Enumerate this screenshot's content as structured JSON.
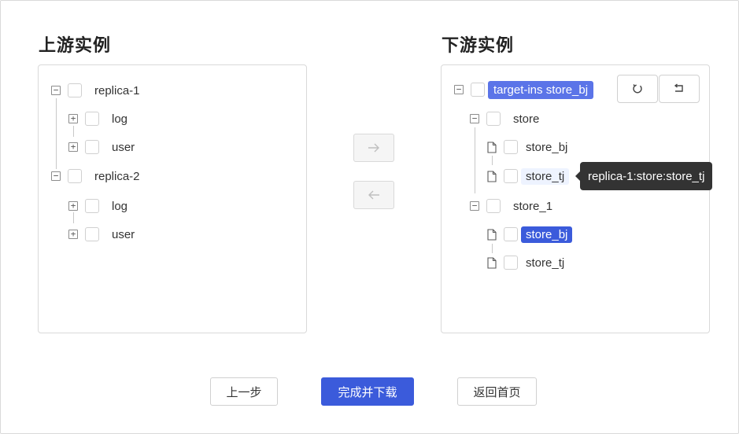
{
  "upstream": {
    "title": "上游实例",
    "nodes": {
      "replica1": {
        "label": "replica-1",
        "children": {
          "log": "log",
          "user": "user"
        }
      },
      "replica2": {
        "label": "replica-2",
        "children": {
          "log": "log",
          "user": "user"
        }
      }
    }
  },
  "transfer": {
    "to_right_icon": "arrow-right-icon",
    "to_left_icon": "arrow-left-icon"
  },
  "downstream": {
    "title": "下游实例",
    "root_label": "target-ins store_bj",
    "refresh_icon": "refresh-icon",
    "undo_icon": "return-icon",
    "store": {
      "label": "store",
      "children": {
        "store_bj": "store_bj",
        "store_tj": "store_tj"
      }
    },
    "store_1": {
      "label": "store_1",
      "children": {
        "store_bj": "store_bj",
        "store_tj": "store_tj"
      }
    },
    "tooltip": "replica-1:store:store_tj"
  },
  "footer": {
    "prev": "上一步",
    "finish": "完成并下载",
    "home": "返回首页"
  },
  "colors": {
    "primary": "#3b5bdb",
    "highlight": "#5b74e8",
    "light_highlight": "#eef3ff"
  }
}
